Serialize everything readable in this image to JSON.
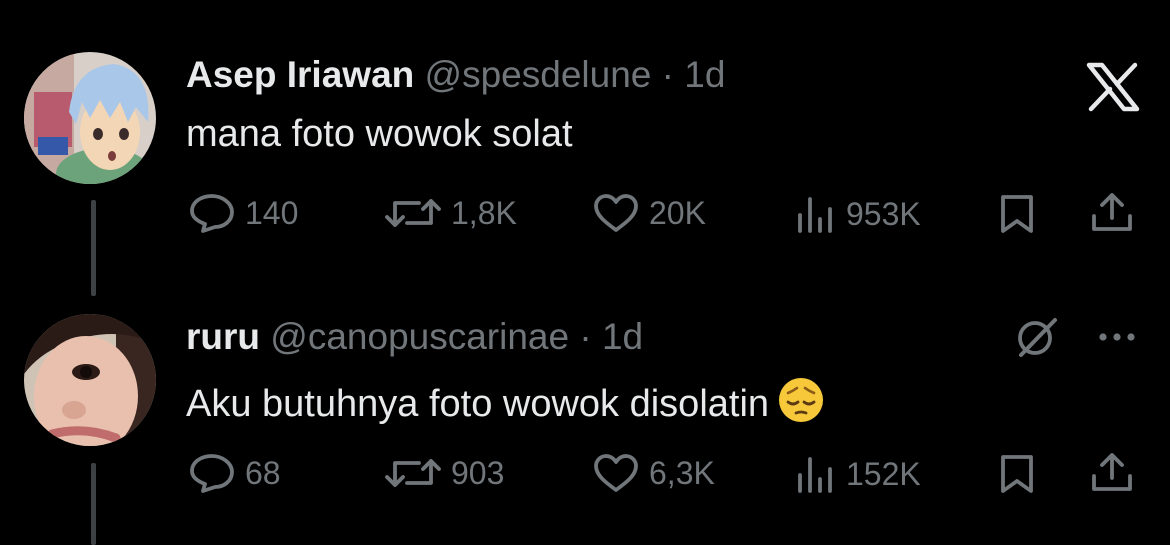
{
  "tweets": [
    {
      "name": "Asep Iriawan",
      "handle": "@spesdelune",
      "separator": "·",
      "time": "1d",
      "text": "mana foto wowok solat",
      "stats": {
        "replies": "140",
        "reposts": "1,8K",
        "likes": "20K",
        "views": "953K"
      }
    },
    {
      "name": "ruru",
      "handle": "@canopuscarinae",
      "separator": "·",
      "time": "1d",
      "text": "Aku butuhnya foto wowok disolatin",
      "emoji": "pensive-face",
      "stats": {
        "replies": "68",
        "reposts": "903",
        "likes": "6,3K",
        "views": "152K"
      }
    }
  ],
  "icons": {
    "top_right": "x-logo-icon",
    "grok": "grok-icon",
    "more": "more-icon"
  },
  "colors": {
    "background": "#000000",
    "text": "#e7e9ea",
    "muted": "#71767b",
    "thread_line": "#3e4144"
  }
}
